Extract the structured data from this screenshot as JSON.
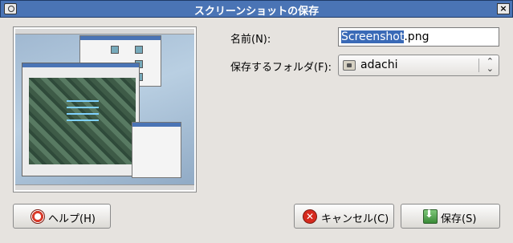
{
  "window": {
    "title": "スクリーンショットの保存",
    "close_glyph": "×"
  },
  "form": {
    "name_label": "名前(N):",
    "filename_selected": "Screenshot",
    "filename_rest": ".png",
    "folder_label": "保存するフォルダ(F):",
    "folder_value": "adachi",
    "folder_arrows": "⌃⌄"
  },
  "buttons": {
    "help": "ヘルプ(H)",
    "cancel": "キャンセル(C)",
    "save": "保存(S)"
  },
  "icons": {
    "app": "screenshot-app-icon",
    "help": "lifebuoy-help-icon",
    "cancel": "cancel-x-icon",
    "save": "save-download-icon",
    "folder": "home-folder-icon"
  },
  "colors": {
    "titlebar": "#4a74b5",
    "selection": "#3a6ab7",
    "dialog_bg": "#e6e3df"
  }
}
